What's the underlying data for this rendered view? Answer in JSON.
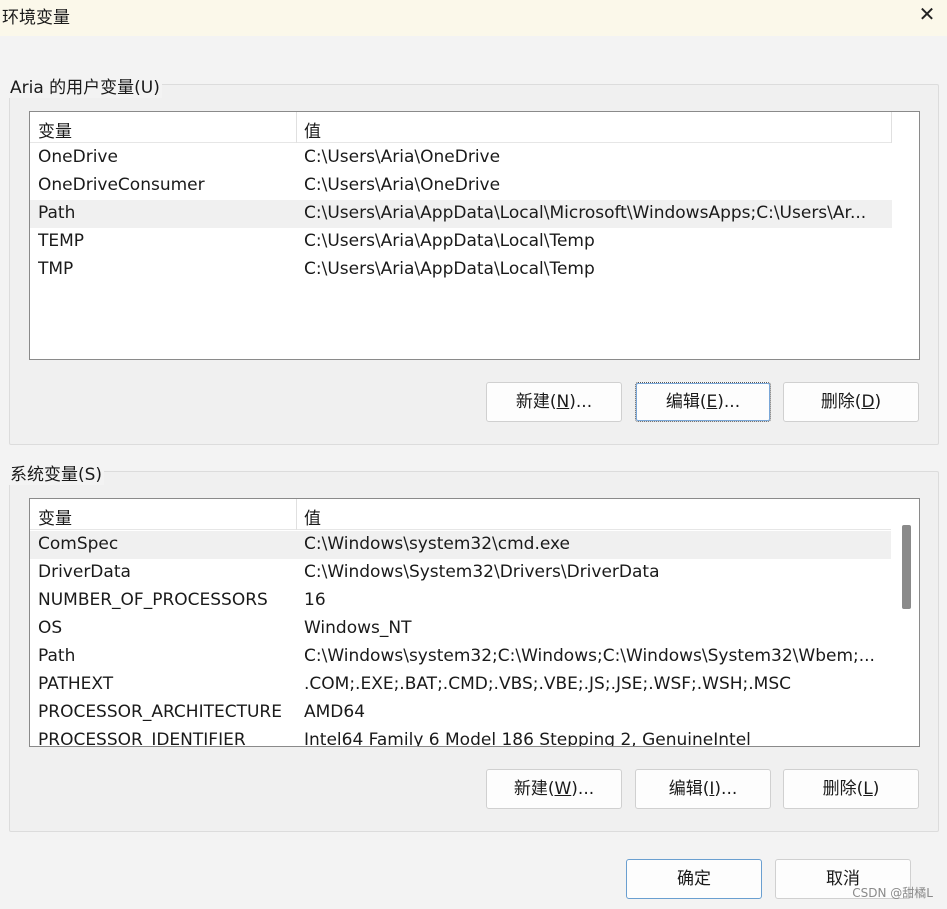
{
  "window": {
    "title": "环境变量",
    "close_icon": "close-icon"
  },
  "user_group": {
    "label": "Aria 的用户变量(U)",
    "columns": [
      "变量",
      "值"
    ],
    "rows": [
      {
        "name": "OneDrive",
        "value": "C:\\Users\\Aria\\OneDrive"
      },
      {
        "name": "OneDriveConsumer",
        "value": "C:\\Users\\Aria\\OneDrive"
      },
      {
        "name": "Path",
        "value": "C:\\Users\\Aria\\AppData\\Local\\Microsoft\\WindowsApps;C:\\Users\\Ar..."
      },
      {
        "name": "TEMP",
        "value": "C:\\Users\\Aria\\AppData\\Local\\Temp"
      },
      {
        "name": "TMP",
        "value": "C:\\Users\\Aria\\AppData\\Local\\Temp"
      }
    ],
    "selected_index": 2,
    "buttons": {
      "new": "新建(N)...",
      "edit": "编辑(E)...",
      "delete": "删除(D)"
    }
  },
  "system_group": {
    "label": "系统变量(S)",
    "columns": [
      "变量",
      "值"
    ],
    "rows": [
      {
        "name": "ComSpec",
        "value": "C:\\Windows\\system32\\cmd.exe"
      },
      {
        "name": "DriverData",
        "value": "C:\\Windows\\System32\\Drivers\\DriverData"
      },
      {
        "name": "NUMBER_OF_PROCESSORS",
        "value": "16"
      },
      {
        "name": "OS",
        "value": "Windows_NT"
      },
      {
        "name": "Path",
        "value": "C:\\Windows\\system32;C:\\Windows;C:\\Windows\\System32\\Wbem;..."
      },
      {
        "name": "PATHEXT",
        "value": ".COM;.EXE;.BAT;.CMD;.VBS;.VBE;.JS;.JSE;.WSF;.WSH;.MSC"
      },
      {
        "name": "PROCESSOR_ARCHITECTURE",
        "value": "AMD64"
      },
      {
        "name": "PROCESSOR_IDENTIFIER",
        "value": "Intel64 Family 6 Model 186 Stepping 2, GenuineIntel"
      }
    ],
    "selected_index": 0,
    "buttons": {
      "new": "新建(W)...",
      "edit": "编辑(I)...",
      "delete": "删除(L)"
    }
  },
  "footer": {
    "ok": "确定",
    "cancel": "取消"
  },
  "watermark": "CSDN @甜橘L"
}
